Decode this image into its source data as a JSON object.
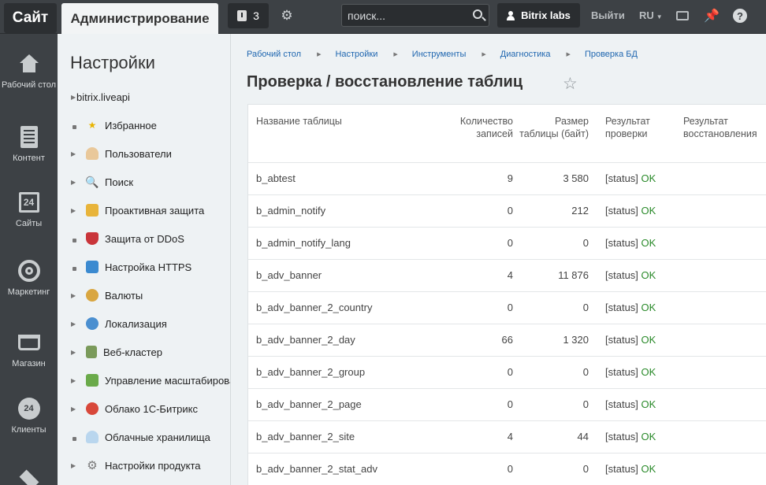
{
  "topbar": {
    "site_tab": "Сайт",
    "admin_tab": "Администрирование",
    "notify_count": "3",
    "search_placeholder": "поиск...",
    "user": "Bitrix labs",
    "logout": "Выйти",
    "lang": "RU"
  },
  "leftmenu": [
    {
      "label": "Рабочий стол",
      "icon": "home-icon"
    },
    {
      "label": "Контент",
      "icon": "document-icon"
    },
    {
      "label": "Сайты",
      "icon": "calendar-24-icon",
      "glyph": "24"
    },
    {
      "label": "Маркетинг",
      "icon": "target-icon"
    },
    {
      "label": "Магазин",
      "icon": "cart-icon"
    },
    {
      "label": "Клиенты",
      "icon": "clients-24-icon",
      "glyph": "24"
    }
  ],
  "sidebar": {
    "title": "Настройки",
    "items": [
      {
        "label": "bitrix.liveapi",
        "marker": "arrow",
        "icon": ""
      },
      {
        "label": "Избранное",
        "marker": "dot",
        "icon": "star-icon"
      },
      {
        "label": "Пользователи",
        "marker": "arrow",
        "icon": "users-icon"
      },
      {
        "label": "Поиск",
        "marker": "arrow",
        "icon": "search-icon"
      },
      {
        "label": "Проактивная защита",
        "marker": "arrow",
        "icon": "lock-icon"
      },
      {
        "label": "Защита от DDoS",
        "marker": "dot",
        "icon": "shield-icon"
      },
      {
        "label": "Настройка HTTPS",
        "marker": "dot",
        "icon": "https-lock-icon"
      },
      {
        "label": "Валюты",
        "marker": "arrow",
        "icon": "currency-icon"
      },
      {
        "label": "Локализация",
        "marker": "arrow",
        "icon": "globe-icon"
      },
      {
        "label": "Веб-кластер",
        "marker": "arrow",
        "icon": "cluster-icon"
      },
      {
        "label": "Управление масштабирова",
        "marker": "arrow",
        "icon": "scale-icon"
      },
      {
        "label": "Облако 1С-Битрикс",
        "marker": "arrow",
        "icon": "cloud-icon"
      },
      {
        "label": "Облачные хранилища",
        "marker": "dot",
        "icon": "storage-icon"
      },
      {
        "label": "Настройки продукта",
        "marker": "arrow",
        "icon": "gear-icon"
      }
    ]
  },
  "breadcrumbs": [
    "Рабочий стол",
    "Настройки",
    "Инструменты",
    "Диагностика",
    "Проверка БД"
  ],
  "page_title": "Проверка / восстановление таблиц",
  "table": {
    "headers": {
      "name": "Название таблицы",
      "count": "Количество записей",
      "size": "Размер таблицы (байт)",
      "check": "Результат проверки",
      "restore": "Результат восстановления"
    },
    "rows": [
      {
        "name": "b_abtest",
        "count": "9",
        "size": "3 580",
        "status": "[status]",
        "result": "OK"
      },
      {
        "name": "b_admin_notify",
        "count": "0",
        "size": "212",
        "status": "[status]",
        "result": "OK"
      },
      {
        "name": "b_admin_notify_lang",
        "count": "0",
        "size": "0",
        "status": "[status]",
        "result": "OK"
      },
      {
        "name": "b_adv_banner",
        "count": "4",
        "size": "11 876",
        "status": "[status]",
        "result": "OK"
      },
      {
        "name": "b_adv_banner_2_country",
        "count": "0",
        "size": "0",
        "status": "[status]",
        "result": "OK"
      },
      {
        "name": "b_adv_banner_2_day",
        "count": "66",
        "size": "1 320",
        "status": "[status]",
        "result": "OK"
      },
      {
        "name": "b_adv_banner_2_group",
        "count": "0",
        "size": "0",
        "status": "[status]",
        "result": "OK"
      },
      {
        "name": "b_adv_banner_2_page",
        "count": "0",
        "size": "0",
        "status": "[status]",
        "result": "OK"
      },
      {
        "name": "b_adv_banner_2_site",
        "count": "4",
        "size": "44",
        "status": "[status]",
        "result": "OK"
      },
      {
        "name": "b_adv_banner_2_stat_adv",
        "count": "0",
        "size": "0",
        "status": "[status]",
        "result": "OK"
      }
    ]
  },
  "colors": {
    "topbar": "#3d4145",
    "link": "#2067b0",
    "ok": "#2a8a2a"
  }
}
